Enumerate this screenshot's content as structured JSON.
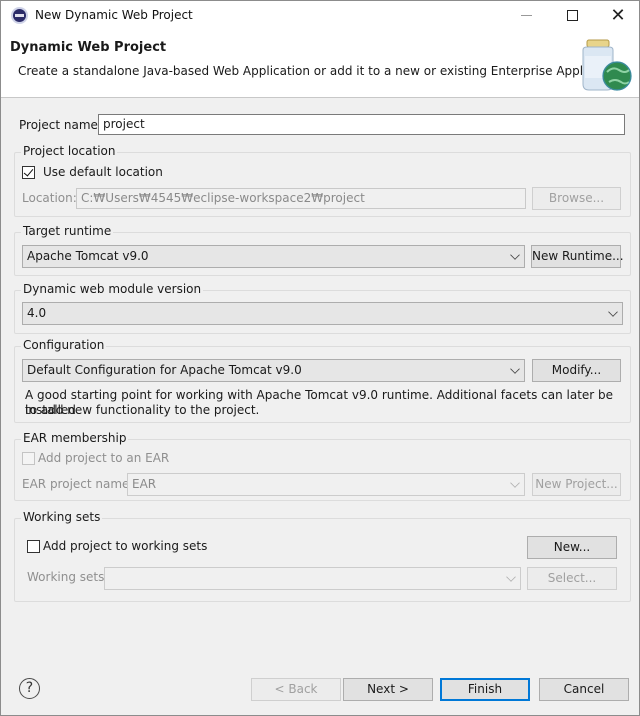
{
  "window": {
    "title": "New Dynamic Web Project",
    "controls": {
      "minimize": "minimize-icon",
      "maximize": "maximize-icon",
      "close": "close-icon"
    }
  },
  "banner": {
    "title": "Dynamic Web Project",
    "description": "Create a standalone Java-based Web Application or add it to a new or existing Enterprise Application.",
    "image": "web-project-jar-globe-icon"
  },
  "project_name": {
    "label": "Project name:",
    "value": "project"
  },
  "project_location": {
    "title": "Project location",
    "use_default": {
      "label": "Use default location",
      "checked": true
    },
    "location_label": "Location:",
    "location_value": "C:₩Users₩4545₩eclipse-workspace2₩project",
    "browse_label": "Browse..."
  },
  "target_runtime": {
    "title": "Target runtime",
    "selected": "Apache Tomcat v9.0",
    "new_runtime_label": "New Runtime..."
  },
  "module_version": {
    "title": "Dynamic web module version",
    "selected": "4.0"
  },
  "configuration": {
    "title": "Configuration",
    "selected": "Default Configuration for Apache Tomcat v9.0",
    "modify_label": "Modify...",
    "description_line1": "A good starting point for working with Apache Tomcat v9.0 runtime. Additional facets can later be installed",
    "description_line2": "to add new functionality to the project."
  },
  "ear": {
    "title": "EAR membership",
    "add_label": "Add project to an EAR",
    "add_checked": false,
    "project_name_label": "EAR project name:",
    "project_name_value": "EAR",
    "new_project_label": "New Project..."
  },
  "working_sets": {
    "title": "Working sets",
    "add_label": "Add project to working sets",
    "add_checked": false,
    "new_label": "New...",
    "sets_label": "Working sets:",
    "sets_value": "",
    "select_label": "Select..."
  },
  "footer": {
    "help_glyph": "?",
    "back_label": "< Back",
    "next_label": "Next >",
    "finish_label": "Finish",
    "cancel_label": "Cancel"
  }
}
